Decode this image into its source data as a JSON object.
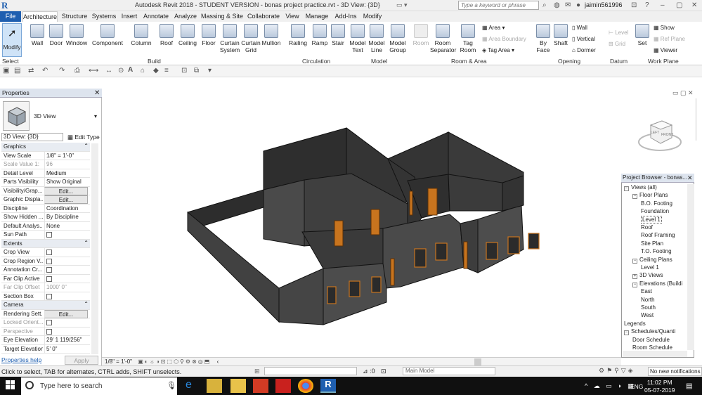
{
  "window": {
    "title": "Autodesk Revit 2018 - STUDENT VERSION -  bonas project practice.rvt - 3D View: {3D}",
    "search_placeholder": "Type a keyword or phrase",
    "user": "jaimin561996",
    "logo": "R"
  },
  "tabs": [
    "File",
    "Architecture",
    "Structure",
    "Systems",
    "Insert",
    "Annotate",
    "Analyze",
    "Massing & Site",
    "Collaborate",
    "View",
    "Manage",
    "Add-Ins",
    "Modify"
  ],
  "ribbon": {
    "select": {
      "label": "Modify",
      "panel": "Select"
    },
    "build": [
      "Wall",
      "Door",
      "Window",
      "Component",
      "Column",
      "Roof",
      "Ceiling",
      "Floor",
      "Curtain System",
      "Curtain Grid",
      "Mullion"
    ],
    "build_panel": "Build",
    "circulation": [
      "Railing",
      "Ramp",
      "Stair"
    ],
    "circulation_panel": "Circulation",
    "model": [
      "Model Text",
      "Model Line",
      "Model Group"
    ],
    "model_panel": "Model",
    "room": [
      "Room",
      "Room Separator",
      "Tag Room"
    ],
    "room_small": [
      "Area",
      "Area Boundary",
      "Tag Area"
    ],
    "room_panel": "Room & Area",
    "opening": [
      "By Face",
      "Shaft"
    ],
    "opening_small": [
      "Wall",
      "Vertical",
      "Dormer"
    ],
    "opening_panel": "Opening",
    "datum_small": [
      "Level",
      "Grid"
    ],
    "datum_panel": "Datum",
    "workplane": [
      "Set"
    ],
    "workplane_small": [
      "Show",
      "Ref Plane",
      "Viewer"
    ],
    "workplane_panel": "Work Plane"
  },
  "properties": {
    "title": "Properties",
    "type_name": "3D View",
    "view_selector": "3D View: {3D}",
    "edit_type": "Edit Type",
    "rows": [
      {
        "name": "Graphics",
        "section": true
      },
      {
        "name": "View Scale",
        "value": "1/8\" = 1'-0\""
      },
      {
        "name": "Scale Value   1:",
        "value": "96",
        "dim": true
      },
      {
        "name": "Detail Level",
        "value": "Medium"
      },
      {
        "name": "Parts Visibility",
        "value": "Show Original"
      },
      {
        "name": "Visibility/Grap...",
        "value": "Edit...",
        "button": true
      },
      {
        "name": "Graphic Displa...",
        "value": "Edit...",
        "button": true
      },
      {
        "name": "Discipline",
        "value": "Coordination"
      },
      {
        "name": "Show Hidden ...",
        "value": "By Discipline"
      },
      {
        "name": "Default Analys...",
        "value": "None"
      },
      {
        "name": "Sun Path",
        "value": "",
        "check": true
      },
      {
        "name": "Extents",
        "section": true
      },
      {
        "name": "Crop View",
        "value": "",
        "check": true
      },
      {
        "name": "Crop Region V...",
        "value": "",
        "check": true
      },
      {
        "name": "Annotation Cr...",
        "value": "",
        "check": true
      },
      {
        "name": "Far Clip Active",
        "value": "",
        "check": true
      },
      {
        "name": "Far Clip Offset",
        "value": "1000'  0\"",
        "dim": true
      },
      {
        "name": "Section Box",
        "value": "",
        "check": true
      },
      {
        "name": "Camera",
        "section": true
      },
      {
        "name": "Rendering Sett...",
        "value": "Edit...",
        "button": true
      },
      {
        "name": "Locked Orient...",
        "value": "",
        "check": true,
        "dim": true
      },
      {
        "name": "Perspective",
        "value": "",
        "check": true,
        "dim": true
      },
      {
        "name": "Eye Elevation",
        "value": "29'  1 119/256\""
      },
      {
        "name": "Target Elevation",
        "value": "5'  0\""
      }
    ],
    "help": "Properties help",
    "apply": "Apply"
  },
  "viewcube": {
    "top": "TOP",
    "left": "LEFT",
    "front": "FRONT"
  },
  "project_browser": {
    "title": "Project Browser - bonas...",
    "items": [
      {
        "label": "Views (all)",
        "level": 0,
        "toggle": "−"
      },
      {
        "label": "Floor Plans",
        "level": 1,
        "toggle": "−"
      },
      {
        "label": "B.O. Footing",
        "level": 2
      },
      {
        "label": "Foundation",
        "level": 2
      },
      {
        "label": "Level 1",
        "level": 2,
        "selected": true
      },
      {
        "label": "Roof",
        "level": 2
      },
      {
        "label": "Roof Framing",
        "level": 2
      },
      {
        "label": "Site Plan",
        "level": 2
      },
      {
        "label": "T.O. Footing",
        "level": 2
      },
      {
        "label": "Ceiling Plans",
        "level": 1,
        "toggle": "−"
      },
      {
        "label": "Level 1",
        "level": 2
      },
      {
        "label": "3D Views",
        "level": 1,
        "toggle": "+"
      },
      {
        "label": "Elevations (Buildi",
        "level": 1,
        "toggle": "−"
      },
      {
        "label": "East",
        "level": 2
      },
      {
        "label": "North",
        "level": 2
      },
      {
        "label": "South",
        "level": 2
      },
      {
        "label": "West",
        "level": 2
      },
      {
        "label": "Legends",
        "level": 0
      },
      {
        "label": "Schedules/Quanti",
        "level": 0,
        "toggle": "−"
      },
      {
        "label": "Door Schedule",
        "level": 1
      },
      {
        "label": "Room Schedule",
        "level": 1
      }
    ]
  },
  "view_control": {
    "scale": "1/8\" = 1'-0\""
  },
  "status": {
    "text": "Click to select, TAB for alternates, CTRL adds, SHIFT unselects.",
    "coord": ":0",
    "model": "Main Model",
    "notification": "No new notifications"
  },
  "taskbar": {
    "search": "Type here to search",
    "lang": "ENG",
    "time": "11:02 PM",
    "date": "05-07-2019"
  },
  "colors": {
    "accent": "#1f5fb0",
    "wall": "#3a3a3a",
    "door": "#c8741e"
  }
}
